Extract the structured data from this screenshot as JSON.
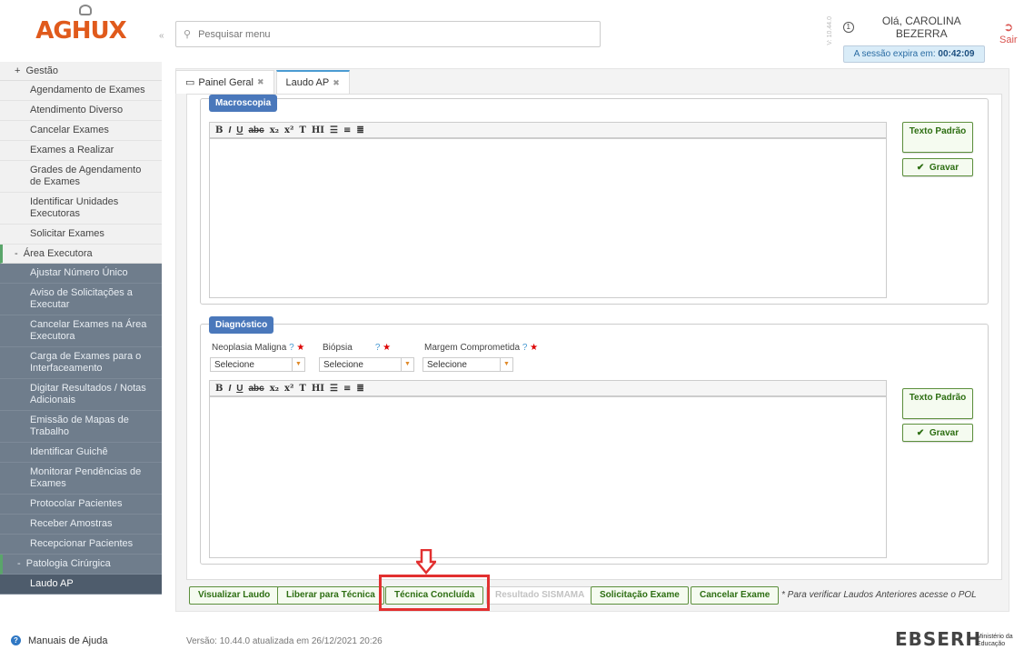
{
  "header": {
    "logo": "AGHUX",
    "search_placeholder": "Pesquisar menu",
    "version_tag": "V: 10.44.0",
    "greeting": "Olá, CAROLINA BEZERRA",
    "session_label": "A sessão expira em:",
    "session_time": "00:42:09",
    "logout": "Sair"
  },
  "sidebar": {
    "group_gestao": "Gestão",
    "gestao_items": [
      "Agendamento de Exames",
      "Atendimento Diverso",
      "Cancelar Exames",
      "Exames a Realizar",
      "Grades de Agendamento de Exames",
      "Identificar Unidades Executoras",
      "Solicitar Exames"
    ],
    "group_area": "Área Executora",
    "area_items": [
      "Ajustar Número Único",
      "Aviso de Solicitações a Executar",
      "Cancelar Exames na Área Executora",
      "Carga de Exames para o Interfaceamento",
      "Digitar Resultados / Notas Adicionais",
      "Emissão de Mapas de Trabalho",
      "Identificar Guichê",
      "Monitorar Pendências de Exames",
      "Protocolar Pacientes",
      "Receber Amostras",
      "Recepcionar Pacientes"
    ],
    "group_patologia": "Patologia Cirúrgica",
    "selected_item": "Laudo AP",
    "help": "Manuais de Ajuda"
  },
  "tabs": [
    {
      "label": "Painel Geral"
    },
    {
      "label": "Laudo AP"
    }
  ],
  "macroscopia": {
    "legend": "Macroscopia",
    "btn_texto": "Texto Padrão",
    "btn_gravar": "Gravar"
  },
  "diagnostico": {
    "legend": "Diagnóstico",
    "field1_label": "Neoplasia Maligna",
    "field2_label": "Biópsia",
    "field3_label": "Margem Comprometida",
    "select_value": "Selecione",
    "btn_texto": "Texto Padrão",
    "btn_gravar": "Gravar"
  },
  "actions": [
    "Visualizar Laudo",
    "Liberar para Técnica",
    "Técnica Concluída",
    "Resultado SISMAMA",
    "Solicitação Exame",
    "Cancelar Exame"
  ],
  "note": "* Para verificar Laudos Anteriores acesse o POL",
  "footer": {
    "version": "Versão: 10.44.0 atualizada em 26/12/2021 20:26",
    "brand": "EBSERH",
    "ministry": "Ministério da Educação"
  }
}
